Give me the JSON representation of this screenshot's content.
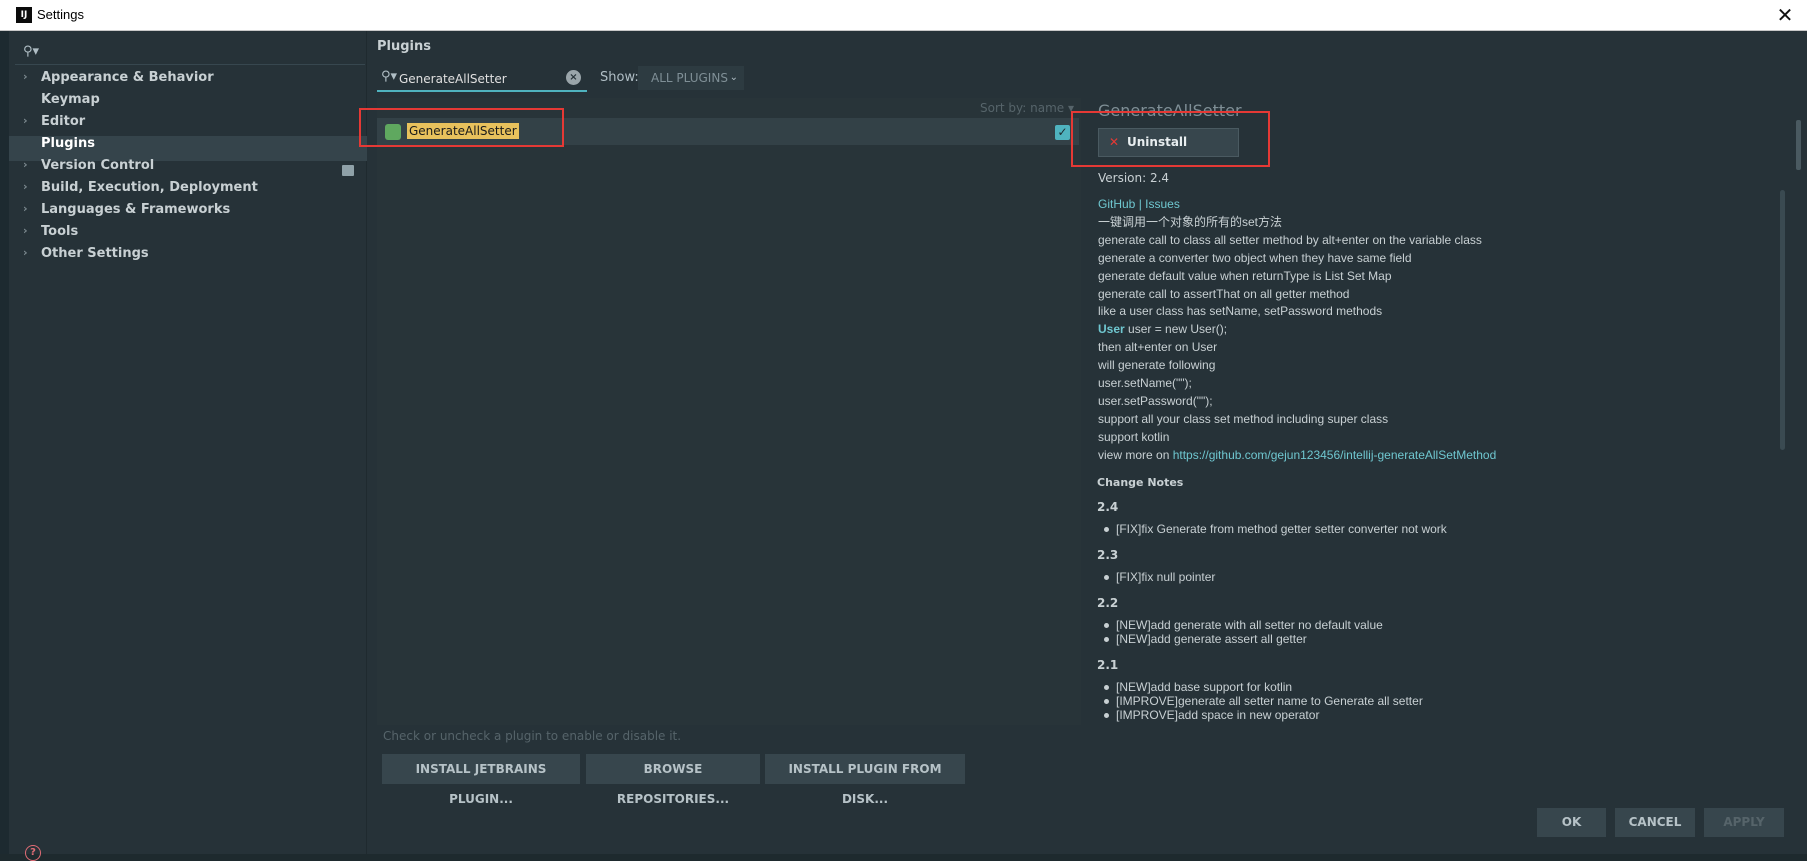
{
  "window": {
    "title": "Settings",
    "logo_text": "IJ",
    "close_glyph": "✕"
  },
  "sidebar": {
    "search_placeholder": "",
    "items": [
      {
        "label": "Appearance & Behavior",
        "expandable": true
      },
      {
        "label": "Keymap",
        "expandable": false
      },
      {
        "label": "Editor",
        "expandable": true
      },
      {
        "label": "Plugins",
        "expandable": false,
        "selected": true
      },
      {
        "label": "Version Control",
        "expandable": true
      },
      {
        "label": "Build, Execution, Deployment",
        "expandable": true
      },
      {
        "label": "Languages & Frameworks",
        "expandable": true
      },
      {
        "label": "Tools",
        "expandable": true
      },
      {
        "label": "Other Settings",
        "expandable": true
      }
    ],
    "help_glyph": "?"
  },
  "main": {
    "title": "Plugins",
    "search": {
      "value": "GenerateAllSetter",
      "clear_glyph": "×"
    },
    "show": {
      "label": "Show:",
      "selected": "ALL PLUGINS"
    },
    "sort_label": "Sort by: name ▾",
    "plugins": [
      {
        "name": "GenerateAllSetter",
        "enabled": true
      }
    ],
    "hint": "Check or uncheck a plugin to enable or disable it.",
    "buttons": {
      "install_jetbrains": "INSTALL JETBRAINS PLUGIN...",
      "browse_repos": "BROWSE REPOSITORIES...",
      "install_disk": "INSTALL PLUGIN FROM DISK..."
    }
  },
  "details": {
    "title": "GenerateAllSetter",
    "uninstall_label": "Uninstall",
    "version": "Version: 2.4",
    "links": {
      "github": "GitHub",
      "separator": " | ",
      "issues": "Issues"
    },
    "lines": [
      "一键调用一个对象的所有的set方法",
      "generate call to class all setter method by alt+enter on the variable class",
      "generate a converter two object when they have same field",
      "generate default value when returnType is List Set Map",
      "generate call to assertThat on all getter method",
      "like a user class has setName, setPassword methods"
    ],
    "user_keyword": "User",
    "user_line_rest": " user = new User();",
    "lines2": [
      "then alt+enter on User",
      "will generate following",
      "user.setName(\"\");",
      "user.setPassword(\"\");",
      "support all your class set method including super class",
      "support kotlin"
    ],
    "view_more_prefix": "view more on ",
    "view_more_link": "https://github.com/gejun123456/intellij-generateAllSetMethod",
    "change_notes_title": "Change Notes",
    "change_notes": [
      {
        "version": "2.4",
        "items": [
          "[FIX]fix Generate from method getter setter converter not work"
        ]
      },
      {
        "version": "2.3",
        "items": [
          "[FIX]fix null pointer"
        ]
      },
      {
        "version": "2.2",
        "items": [
          "[NEW]add generate with all setter no default value",
          "[NEW]add generate assert all getter"
        ]
      },
      {
        "version": "2.1",
        "items": [
          "[NEW]add base support for kotlin",
          "[IMPROVE]generate all setter name to Generate all setter",
          "[IMPROVE]add space in new operator"
        ]
      }
    ]
  },
  "footer": {
    "ok": "OK",
    "cancel": "CANCEL",
    "apply": "APPLY"
  },
  "colors": {
    "background": "#263238",
    "accent": "#4fb3bf",
    "highlight": "#e8c15c",
    "annotation_red": "#e53935"
  }
}
